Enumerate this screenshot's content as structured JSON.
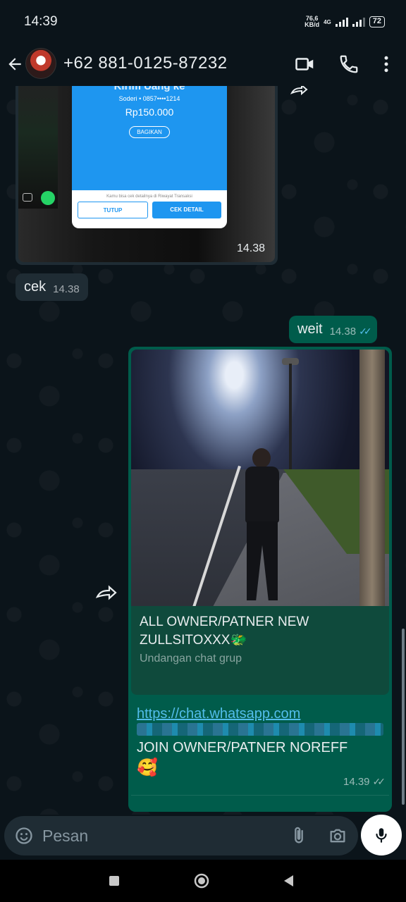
{
  "status_bar": {
    "time": "14:39",
    "net_speed_value": "76,6",
    "net_speed_unit": "KB/d",
    "network_type": "4G",
    "battery": "72"
  },
  "header": {
    "contact_name": "+62 881-0125-87232",
    "icons": [
      "back-arrow-icon",
      "video-call-icon",
      "phone-call-icon",
      "more-options-icon"
    ]
  },
  "messages": {
    "image_in": {
      "card_title": "Kirim Uang ke",
      "card_recipient": "Soderi • 0857••••1214",
      "card_amount": "Rp150.000",
      "card_share": "BAGIKAN",
      "card_note": "Kamu bisa cek detailnya di Riwayat Transaksi",
      "card_btn_close": "TUTUP",
      "card_btn_detail": "CEK DETAIL",
      "time": "14.38"
    },
    "text_in": {
      "text": "cek",
      "time": "14.38"
    },
    "text_out": {
      "text": "weit",
      "time": "14.38",
      "status": "read"
    },
    "link_out": {
      "preview_title": "ALL OWNER/PATNER NEW ZULLSITOXXX🐲",
      "preview_subtitle": "Undangan chat grup",
      "url": "https://chat.whatsapp.com",
      "body": "JOIN OWNER/PATNER NOREFF",
      "emoji": "🥰",
      "time": "14.39",
      "status": "delivered"
    }
  },
  "input": {
    "placeholder": "Pesan",
    "icons": [
      "emoji-icon",
      "attach-icon",
      "camera-icon",
      "mic-icon"
    ]
  },
  "colors": {
    "background": "#0b141a",
    "bubble_in": "#1f2c34",
    "bubble_out": "#005c4b",
    "link": "#53bdeb",
    "read_tick": "#53bdeb"
  }
}
